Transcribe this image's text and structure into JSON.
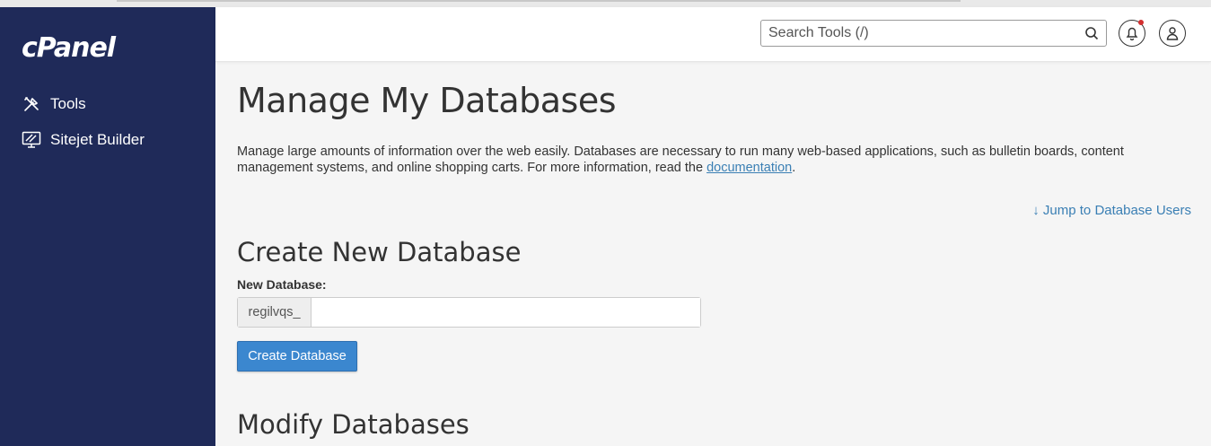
{
  "sidebar": {
    "logo": "cPanel",
    "items": [
      {
        "label": "Tools",
        "icon": "tools-icon"
      },
      {
        "label": "Sitejet Builder",
        "icon": "sitejet-icon"
      }
    ]
  },
  "header": {
    "search_placeholder": "Search Tools (/)"
  },
  "main": {
    "title": "Manage My Databases",
    "description_text": "Manage large amounts of information over the web easily. Databases are necessary to run many web-based applications, such as bulletin boards, content management systems, and online shopping carts. For more information, read the ",
    "description_link": "documentation",
    "description_end": ".",
    "jump_link": "↓ Jump to Database Users",
    "create_section": {
      "title": "Create New Database",
      "field_label": "New Database:",
      "prefix": "regilvqs_",
      "input_value": "",
      "button_label": "Create Database"
    },
    "modify_section": {
      "title": "Modify Databases"
    }
  },
  "colors": {
    "sidebar_bg": "#1f2a59",
    "accent": "#3b87cf",
    "link": "#3a7fb4",
    "notification_dot": "#d32f2f"
  }
}
